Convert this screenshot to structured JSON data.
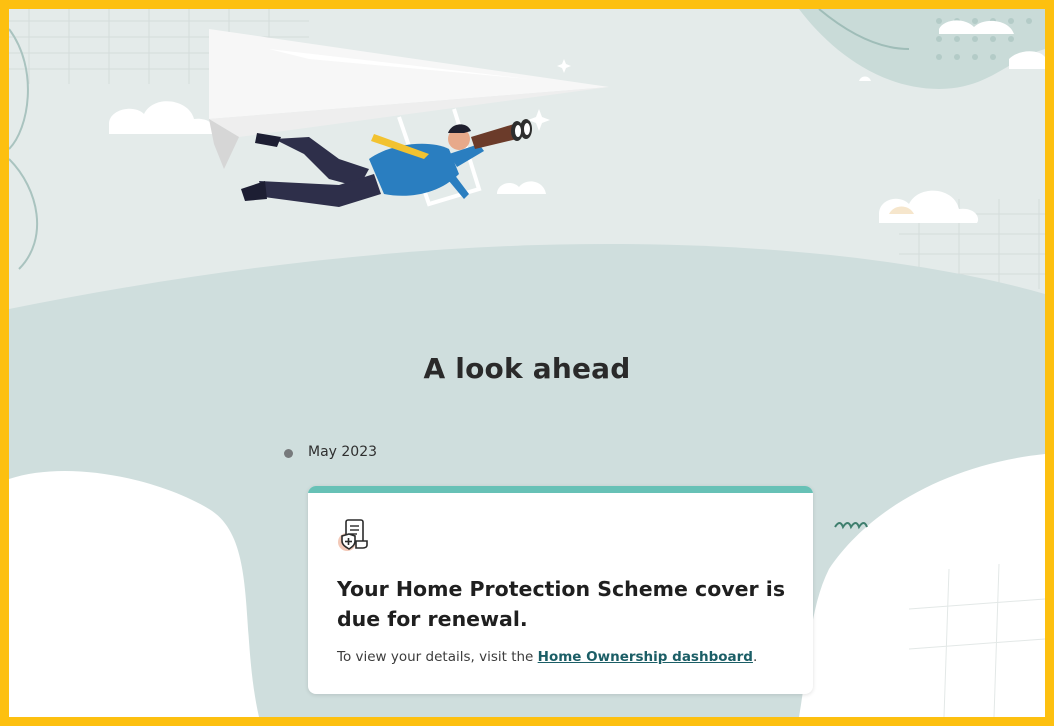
{
  "section": {
    "title": "A look ahead"
  },
  "timeline": {
    "date": "May 2023"
  },
  "card": {
    "icon": "policy-document-shield-icon",
    "heading": "Your Home Protection Scheme cover is due for renewal.",
    "text_before": "To view your details, visit the ",
    "link_label": "Home Ownership dashboard",
    "text_after": "."
  },
  "colors": {
    "frame_border": "#fdc010",
    "accent_bar": "#67c1b6",
    "link": "#1b5e66"
  }
}
